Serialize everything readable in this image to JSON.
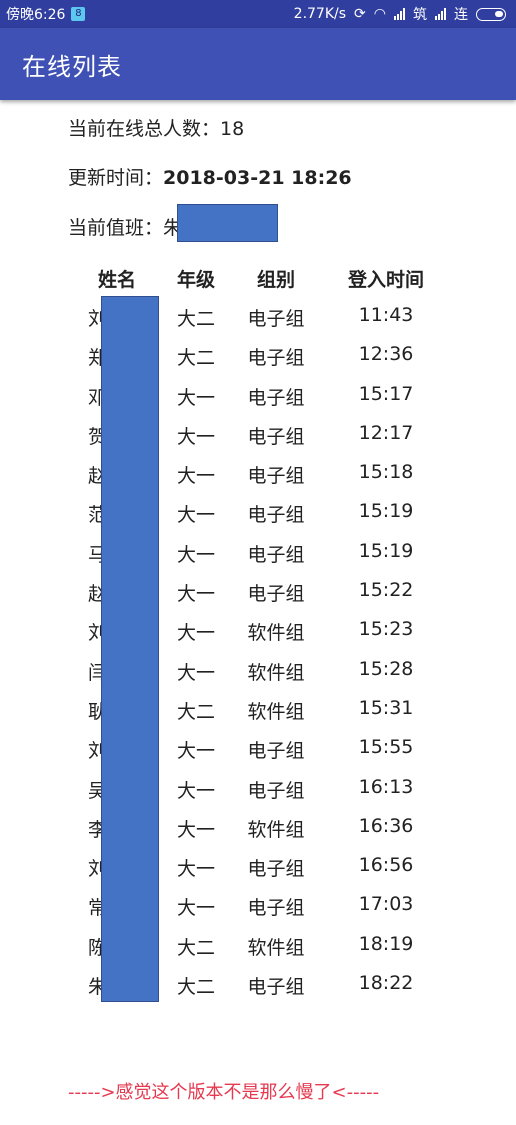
{
  "status_bar": {
    "time": "傍晚6:26",
    "sim_badge": "8",
    "speed": "2.77K/s",
    "carrier1": "筑",
    "carrier2": "连"
  },
  "app_bar": {
    "title": "在线列表"
  },
  "summary": {
    "count_label": "当前在线总人数：",
    "count_value": "18",
    "update_label": "更新时间：",
    "update_value": "2018-03-21 18:26",
    "duty_label": "当前值班：",
    "duty_value": "朱"
  },
  "table": {
    "headers": [
      "姓名",
      "年级",
      "组别",
      "登入时间"
    ],
    "rows": [
      {
        "name": "刘",
        "grade": "大二",
        "group": "电子组",
        "time": "11:43"
      },
      {
        "name": "郑",
        "grade": "大二",
        "group": "电子组",
        "time": "12:36"
      },
      {
        "name": "邓",
        "grade": "大一",
        "group": "电子组",
        "time": "15:17"
      },
      {
        "name": "贺",
        "grade": "大一",
        "group": "电子组",
        "time": "12:17"
      },
      {
        "name": "赵",
        "grade": "大一",
        "group": "电子组",
        "time": "15:18"
      },
      {
        "name": "范",
        "grade": "大一",
        "group": "电子组",
        "time": "15:19"
      },
      {
        "name": "马",
        "grade": "大一",
        "group": "电子组",
        "time": "15:19"
      },
      {
        "name": "赵",
        "grade": "大一",
        "group": "电子组",
        "time": "15:22"
      },
      {
        "name": "刘",
        "grade": "大一",
        "group": "软件组",
        "time": "15:23"
      },
      {
        "name": "闫",
        "grade": "大一",
        "group": "软件组",
        "time": "15:28"
      },
      {
        "name": "耿",
        "grade": "大二",
        "group": "软件组",
        "time": "15:31"
      },
      {
        "name": "刘",
        "grade": "大一",
        "group": "电子组",
        "time": "15:55"
      },
      {
        "name": "吴",
        "grade": "大一",
        "group": "电子组",
        "time": "16:13"
      },
      {
        "name": "李",
        "grade": "大一",
        "group": "软件组",
        "time": "16:36"
      },
      {
        "name": "刘",
        "grade": "大一",
        "group": "电子组",
        "time": "16:56"
      },
      {
        "name": "常",
        "grade": "大一",
        "group": "电子组",
        "time": "17:03"
      },
      {
        "name": "陈",
        "grade": "大二",
        "group": "软件组",
        "time": "18:19"
      },
      {
        "name": "朱",
        "grade": "大二",
        "group": "电子组",
        "time": "18:22"
      }
    ]
  },
  "footer_note": "----->感觉这个版本不是那么慢了<-----",
  "colors": {
    "status_bar": "#303f9f",
    "app_bar": "#3f51b5",
    "redaction": "#4472c4",
    "note": "#e53950"
  }
}
